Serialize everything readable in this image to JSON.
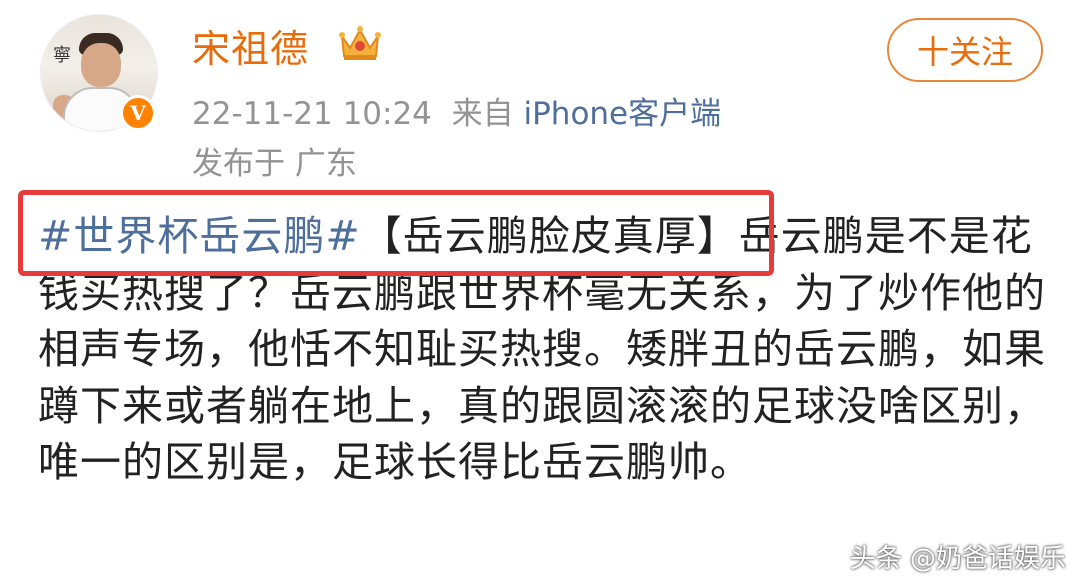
{
  "user": {
    "name": "宋祖德",
    "verified_mark": "V"
  },
  "post_meta": {
    "timestamp": "22-11-21 10:24",
    "from_label": "来自 ",
    "client": "iPhone客户端",
    "location": "发布于 广东"
  },
  "follow_button": {
    "label": "十关注"
  },
  "content": {
    "topic": "#世界杯岳云鹏#",
    "headline": "【岳云鹏脸皮真厚】",
    "body": "岳云鹏是不是花钱买热搜了？岳云鹏跟世界杯毫无关系，为了炒作他的相声专场，他恬不知耻买热搜。矮胖丑的岳云鹏，如果蹲下来或者躺在地上，真的跟圆滚滚的足球没啥区别，唯一的区别是，足球长得比岳云鹏帅。"
  },
  "avatar_text": "寧",
  "watermark": "头条 @奶爸话娱乐",
  "colors": {
    "username": "#e86b0c",
    "link": "#4e6e9b",
    "meta": "#939393",
    "highlight_border": "#e63b3b",
    "verify_badge": "#ff8200"
  },
  "icons": [
    "crown-icon",
    "verified-badge-icon"
  ]
}
